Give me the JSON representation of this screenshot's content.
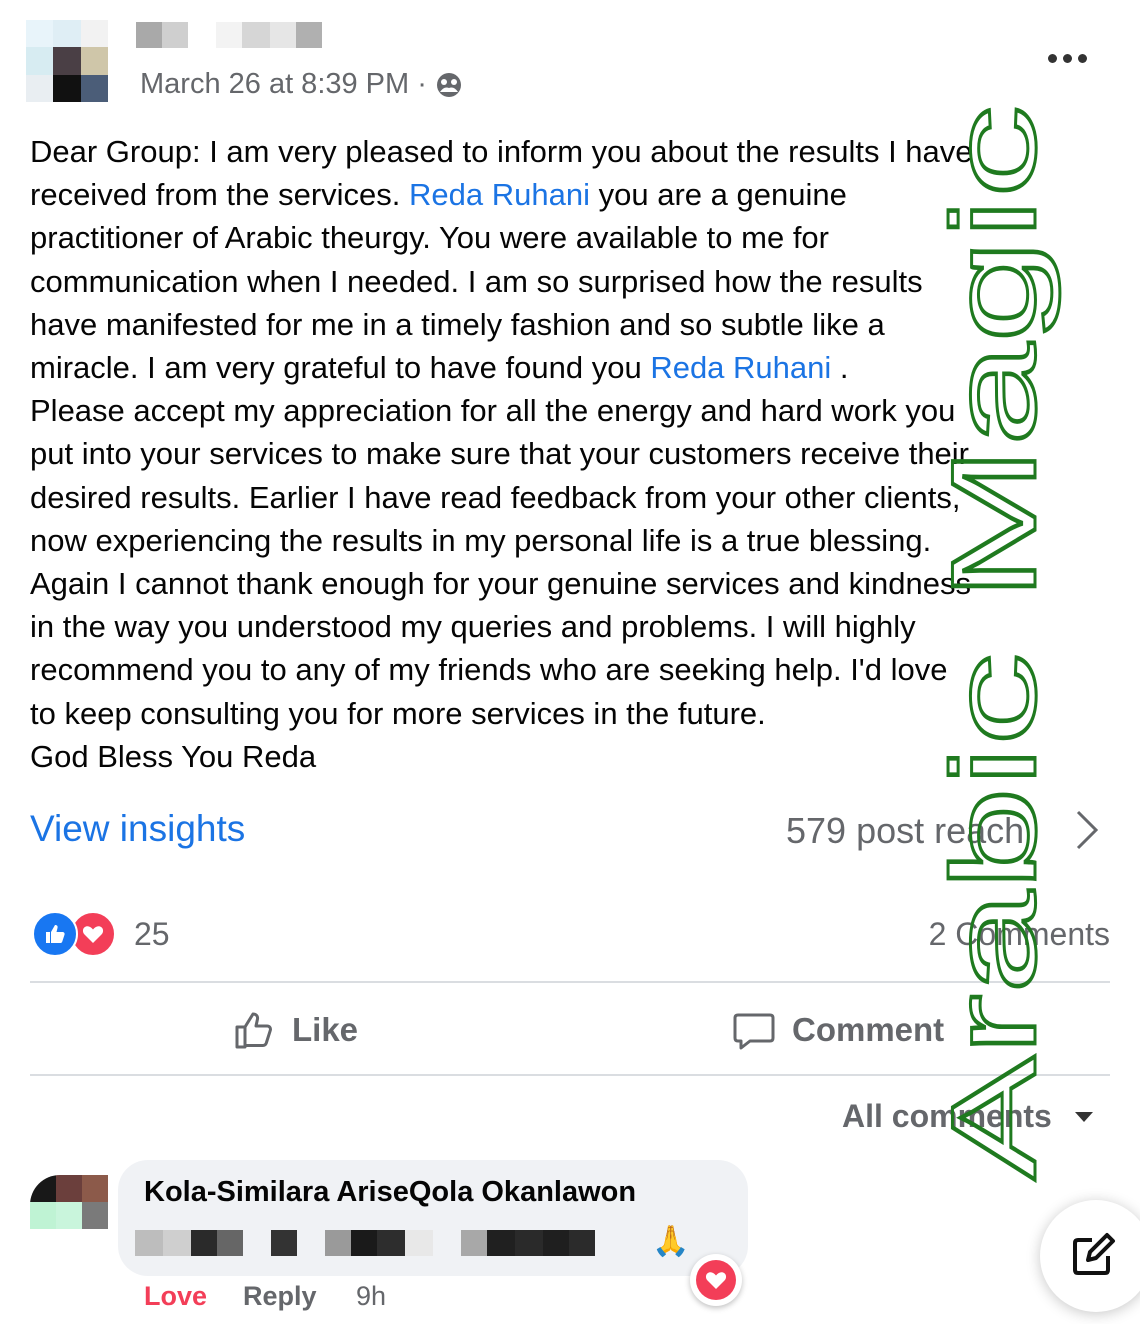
{
  "colors": {
    "mention": "#1b74e4",
    "secondary_text": "#65676b",
    "love": "#f33e58",
    "like": "#1877f2",
    "watermark": "#1f7a1f"
  },
  "post": {
    "timestamp": "March 26 at 8:39 PM ·",
    "privacy_icon": "group-icon",
    "more_icon": "more-horizontal-icon",
    "body_lines": [
      [
        {
          "t": "Dear Group:  I am very pleased to inform you about the results I have"
        }
      ],
      [
        {
          "t": "received from the services. "
        },
        {
          "t": "Reda Ruhani",
          "link": true
        },
        {
          "t": "  you are a genuine"
        }
      ],
      [
        {
          "t": "practitioner of Arabic theurgy. You were available to me for"
        }
      ],
      [
        {
          "t": "communication when I needed. I am so surprised how the results"
        }
      ],
      [
        {
          "t": "have manifested for me in a timely fashion and so subtle like a"
        }
      ],
      [
        {
          "t": "miracle. I am very grateful to have found you "
        },
        {
          "t": "Reda Ruhani",
          "link": true
        },
        {
          "t": " ."
        }
      ],
      [
        {
          "t": " Please accept my appreciation for all the energy and hard work you"
        }
      ],
      [
        {
          "t": "put into your services to make sure that your customers receive their"
        }
      ],
      [
        {
          "t": "desired results. Earlier I have read feedback from your other clients,"
        }
      ],
      [
        {
          "t": "now experiencing the results in my personal life is a true blessing."
        }
      ],
      [
        {
          "t": "Again I cannot thank enough for your genuine services and kindness"
        }
      ],
      [
        {
          "t": "in the way you understood my queries and problems. I will highly"
        }
      ],
      [
        {
          "t": "recommend you to any of my friends who are seeking help.  I'd love"
        }
      ],
      [
        {
          "t": "to keep consulting you for more services in the future."
        }
      ],
      [
        {
          "t": "God Bless You Reda"
        }
      ]
    ]
  },
  "insights": {
    "link_label": "View insights",
    "reach_label": "579 post reach"
  },
  "reactions": {
    "count": "25",
    "comments_count": "2 Comments"
  },
  "actions": {
    "like_label": "Like",
    "comment_label": "Comment"
  },
  "comments_filter": {
    "label": "All comments"
  },
  "comment": {
    "author": "Kola-Similara AriseQola Okanlawon",
    "emoji": "🙏",
    "love_label": "Love",
    "reply_label": "Reply",
    "time": "9h"
  },
  "watermark": {
    "text": "Arabic Magic"
  }
}
